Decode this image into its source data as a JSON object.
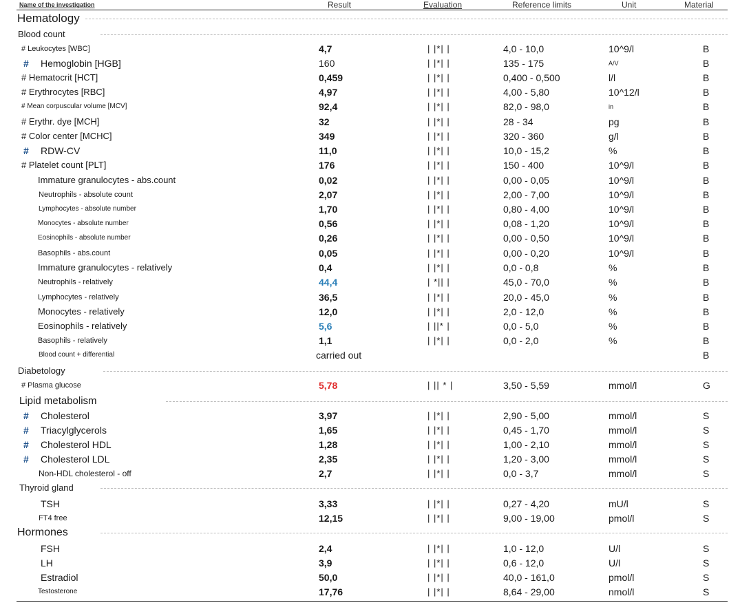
{
  "header": {
    "name": "Name of the investigation",
    "result": "Result",
    "evaluation": "Evaluation",
    "reference": "Reference limits",
    "unit": "Unit",
    "material": "Material"
  },
  "colors": {
    "low": "#2a7fb8",
    "high": "#e02b2b",
    "hash": "#1b4f8a"
  },
  "sections": {
    "hematology": "Hematology",
    "blood_count": "Blood count",
    "diabetology": "Diabetology",
    "lipid": "Lipid metabolism",
    "thyroid": "Thyroid gland",
    "hormones": "Hormones"
  },
  "rows": [
    {
      "name": "# Leukocytes [WBC]",
      "result": "4,7",
      "eval": "| |*| |",
      "ref": "4,0 - 10,0",
      "unit": "10^9/l",
      "mat": "B"
    },
    {
      "name": "Hemoglobin [HGB]",
      "result": "160",
      "eval": "| |*| |",
      "ref": "135 - 175",
      "unit": "A/V",
      "mat": "B"
    },
    {
      "name": "# Hematocrit [HCT]",
      "result": "0,459",
      "eval": "| |*| |",
      "ref": "0,400 - 0,500",
      "unit": "l/l",
      "mat": "B"
    },
    {
      "name": "# Erythrocytes [RBC]",
      "result": "4,97",
      "eval": "| |*| |",
      "ref": "4,00 - 5,80",
      "unit": "10^12/l",
      "mat": "B"
    },
    {
      "name": "# Mean corpuscular volume [MCV]",
      "result": "92,4",
      "eval": "| |*| |",
      "ref": "82,0 - 98,0",
      "unit": "in",
      "mat": "B"
    },
    {
      "name": "# Erythr. dye [MCH]",
      "result": "32",
      "eval": "| |*| |",
      "ref": "28 - 34",
      "unit": "pg",
      "mat": "B"
    },
    {
      "name": "# Color center [MCHC]",
      "result": "349",
      "eval": "| |*| |",
      "ref": "320 - 360",
      "unit": "g/l",
      "mat": "B"
    },
    {
      "name": "RDW-CV",
      "result": "11,0",
      "eval": "| |*| |",
      "ref": "10,0 - 15,2",
      "unit": "%",
      "mat": "B"
    },
    {
      "name": "# Platelet count [PLT]",
      "result": "176",
      "eval": "| |*| |",
      "ref": "150 - 400",
      "unit": "10^9/l",
      "mat": "B"
    },
    {
      "name": "Immature granulocytes - abs.count",
      "result": "0,02",
      "eval": "| |*| |",
      "ref": "0,00 - 0,05",
      "unit": "10^9/l",
      "mat": "B"
    },
    {
      "name": "Neutrophils - absolute count",
      "result": "2,07",
      "eval": "| |*| |",
      "ref": "2,00 - 7,00",
      "unit": "10^9/l",
      "mat": "B"
    },
    {
      "name": "Lymphocytes - absolute number",
      "result": "1,70",
      "eval": "| |*| |",
      "ref": "0,80 - 4,00",
      "unit": "10^9/l",
      "mat": "B"
    },
    {
      "name": "Monocytes - absolute number",
      "result": "0,56",
      "eval": "| |*| |",
      "ref": "0,08 - 1,20",
      "unit": "10^9/l",
      "mat": "B"
    },
    {
      "name": "Eosinophils - absolute number",
      "result": "0,26",
      "eval": "| |*| |",
      "ref": "0,00 - 0,50",
      "unit": "10^9/l",
      "mat": "B"
    },
    {
      "name": "Basophils - abs.count",
      "result": "0,05",
      "eval": "| |*| |",
      "ref": "0,00 - 0,20",
      "unit": "10^9/l",
      "mat": "B"
    },
    {
      "name": "Immature granulocytes - relatively",
      "result": "0,4",
      "eval": "| |*| |",
      "ref": "0,0 - 0,8",
      "unit": "%",
      "mat": "B"
    },
    {
      "name": "Neutrophils - relatively",
      "result": "44,4",
      "eval": "| *|| |",
      "ref": "45,0 - 70,0",
      "unit": "%",
      "mat": "B"
    },
    {
      "name": "Lymphocytes - relatively",
      "result": "36,5",
      "eval": "| |*| |",
      "ref": "20,0 - 45,0",
      "unit": "%",
      "mat": "B"
    },
    {
      "name": "Monocytes - relatively",
      "result": "12,0",
      "eval": "| |*| |",
      "ref": "2,0 - 12,0",
      "unit": "%",
      "mat": "B"
    },
    {
      "name": "Eosinophils - relatively",
      "result": "5,6",
      "eval": "| ||* |",
      "ref": "0,0 - 5,0",
      "unit": "%",
      "mat": "B"
    },
    {
      "name": "Basophils - relatively",
      "result": "1,1",
      "eval": "| |*| |",
      "ref": "0,0 - 2,0",
      "unit": "%",
      "mat": "B"
    },
    {
      "name": "Blood count + differential",
      "result": "carried out",
      "eval": "",
      "ref": "",
      "unit": "",
      "mat": "B"
    },
    {
      "name": "# Plasma glucose",
      "result": "5,78",
      "eval": "| || * |",
      "ref": "3,50 - 5,59",
      "unit": "mmol/l",
      "mat": "G"
    },
    {
      "name": "Cholesterol",
      "result": "3,97",
      "eval": "| |*| |",
      "ref": "2,90 - 5,00",
      "unit": "mmol/l",
      "mat": "S"
    },
    {
      "name": "Triacylglycerols",
      "result": "1,65",
      "eval": "| |*| |",
      "ref": "0,45 - 1,70",
      "unit": "mmol/l",
      "mat": "S"
    },
    {
      "name": "Cholesterol HDL",
      "result": "1,28",
      "eval": "| |*| |",
      "ref": "1,00 - 2,10",
      "unit": "mmol/l",
      "mat": "S"
    },
    {
      "name": "Cholesterol LDL",
      "result": "2,35",
      "eval": "| |*| |",
      "ref": "1,20 - 3,00",
      "unit": "mmol/l",
      "mat": "S"
    },
    {
      "name": "Non-HDL cholesterol - off",
      "result": "2,7",
      "eval": "| |*| |",
      "ref": "0,0 - 3,7",
      "unit": "mmol/l",
      "mat": "S"
    },
    {
      "name": "TSH",
      "result": "3,33",
      "eval": "| |*| |",
      "ref": "0,27 - 4,20",
      "unit": "mU/l",
      "mat": "S"
    },
    {
      "name": "FT4 free",
      "result": "12,15",
      "eval": "| |*| |",
      "ref": "9,00 - 19,00",
      "unit": "pmol/l",
      "mat": "S"
    },
    {
      "name": "FSH",
      "result": "2,4",
      "eval": "| |*| |",
      "ref": "1,0 - 12,0",
      "unit": "U/l",
      "mat": "S"
    },
    {
      "name": "LH",
      "result": "3,9",
      "eval": "| |*| |",
      "ref": "0,6 - 12,0",
      "unit": "U/l",
      "mat": "S"
    },
    {
      "name": "Estradiol",
      "result": "50,0",
      "eval": "| |*| |",
      "ref": "40,0 - 161,0",
      "unit": "pmol/l",
      "mat": "S"
    },
    {
      "name": "Testosterone",
      "result": "17,76",
      "eval": "| |*| |",
      "ref": "8,64 - 29,00",
      "unit": "nmol/l",
      "mat": "S"
    }
  ],
  "hash_mark": "#"
}
